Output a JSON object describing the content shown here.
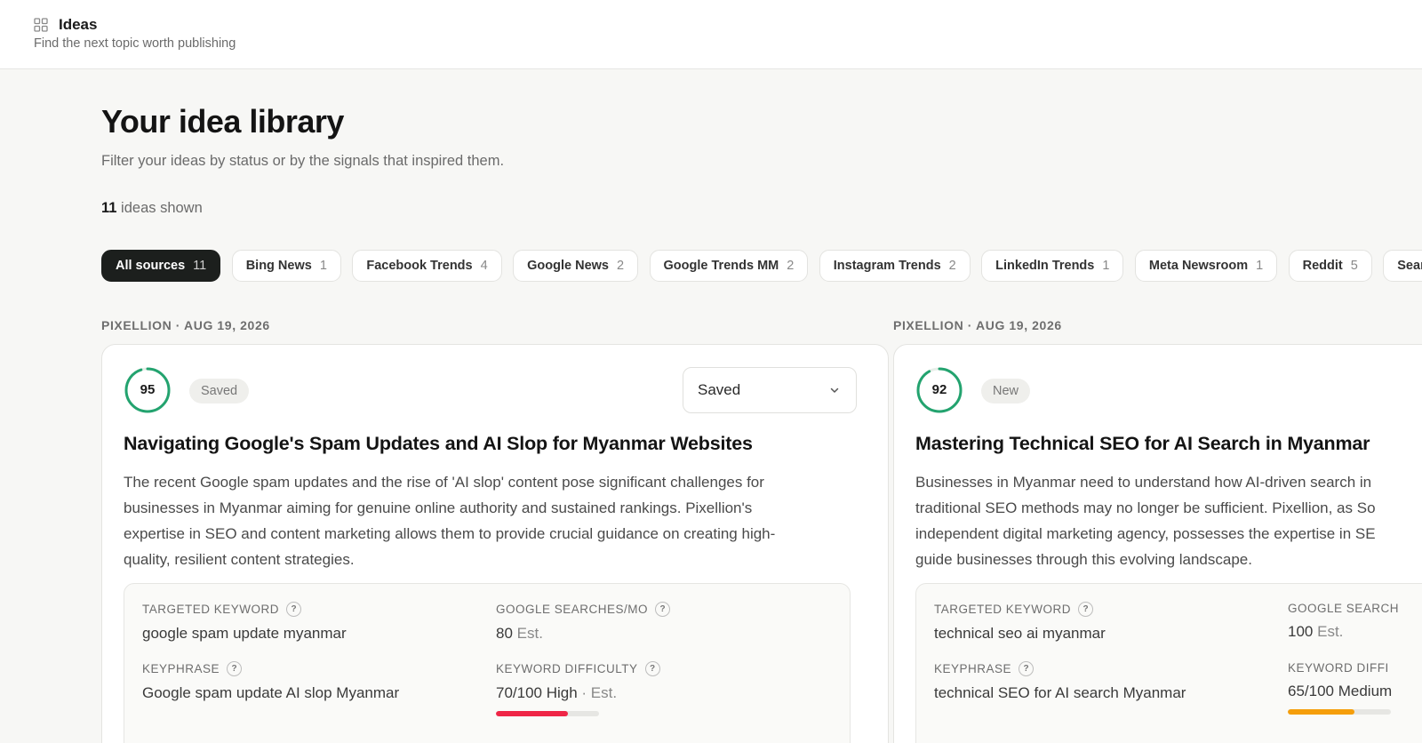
{
  "header": {
    "title": "Ideas",
    "subtitle": "Find the next topic worth publishing"
  },
  "library": {
    "title": "Your idea library",
    "subtitle": "Filter your ideas by status or by the signals that inspired them.",
    "count_number": "11",
    "count_suffix": "ideas shown"
  },
  "filters": [
    {
      "label": "All sources",
      "count": "11",
      "active": true
    },
    {
      "label": "Bing News",
      "count": "1"
    },
    {
      "label": "Facebook Trends",
      "count": "4"
    },
    {
      "label": "Google News",
      "count": "2"
    },
    {
      "label": "Google Trends MM",
      "count": "2"
    },
    {
      "label": "Instagram Trends",
      "count": "2"
    },
    {
      "label": "LinkedIn Trends",
      "count": "1"
    },
    {
      "label": "Meta Newsroom",
      "count": "1"
    },
    {
      "label": "Reddit",
      "count": "5"
    },
    {
      "label": "Sear",
      "count": ""
    }
  ],
  "colors": {
    "score_ring": "#23a36f",
    "difficulty_high": "#ef2546",
    "difficulty_medium": "#f59e0b"
  },
  "cards": [
    {
      "meta": "PIXELLION · AUG 19, 2026",
      "score": "95",
      "score_fraction": 0.95,
      "status": "Saved",
      "status_select": "Saved",
      "title": "Navigating Google's Spam Updates and AI Slop for Myanmar Websites",
      "body_lines": [
        "The recent Google spam updates and the rise of 'AI slop' content pose significant challenges for",
        "businesses in Myanmar aiming for genuine online authority and sustained rankings. Pixellion's",
        "expertise in SEO and content marketing allows them to provide crucial guidance on creating high-",
        "quality, resilient content strategies."
      ],
      "targeted_keyword_label": "TARGETED KEYWORD",
      "targeted_keyword": "google spam update myanmar",
      "searches_label": "GOOGLE SEARCHES/MO",
      "searches_value": "80",
      "searches_est": "Est.",
      "keyphrase_label": "KEYPHRASE",
      "keyphrase": "Google spam update AI slop Myanmar",
      "difficulty_label": "KEYWORD DIFFICULTY",
      "difficulty_value": "70/100 High",
      "difficulty_est": "· Est.",
      "difficulty_fraction": 0.7,
      "difficulty_color": "#ef2546"
    },
    {
      "meta": "PIXELLION · AUG 19, 2026",
      "score": "92",
      "score_fraction": 0.92,
      "status": "New",
      "title": "Mastering Technical SEO for AI Search in Myanmar",
      "body_lines": [
        "Businesses in Myanmar need to understand how AI-driven search in",
        "traditional SEO methods may no longer be sufficient. Pixellion, as So",
        "independent digital marketing agency, possesses the expertise in SE",
        "guide businesses through this evolving landscape."
      ],
      "targeted_keyword_label": "TARGETED KEYWORD",
      "targeted_keyword": "technical seo ai myanmar",
      "searches_label": "GOOGLE SEARCH",
      "searches_value": "100",
      "searches_est": "Est.",
      "keyphrase_label": "KEYPHRASE",
      "keyphrase": "technical SEO for AI search Myanmar",
      "difficulty_label": "KEYWORD DIFFI",
      "difficulty_value": "65/100 Medium",
      "difficulty_est": "",
      "difficulty_fraction": 0.65,
      "difficulty_color": "#f59e0b"
    }
  ]
}
